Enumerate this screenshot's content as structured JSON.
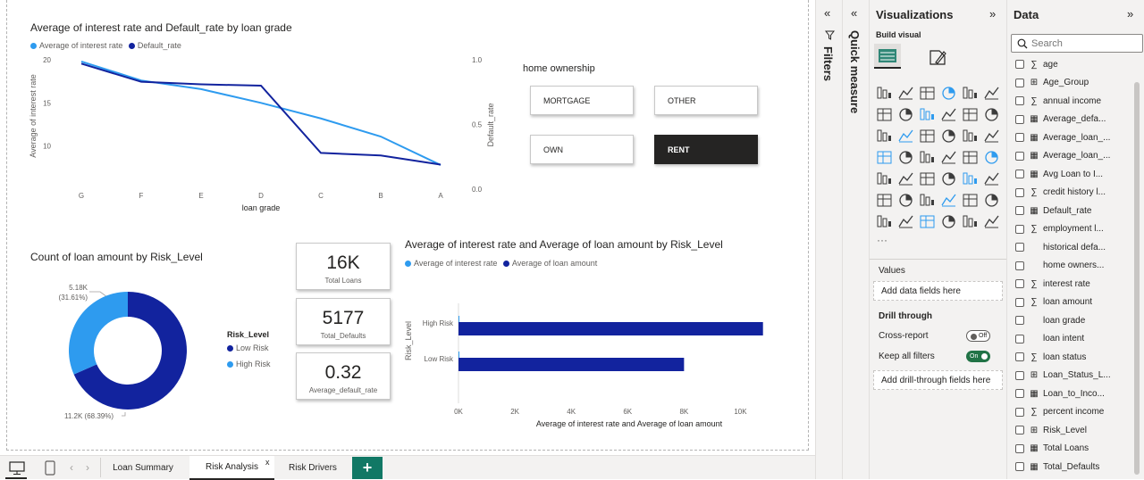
{
  "line_chart": {
    "title": "Average of interest rate and Default_rate by loan grade",
    "legend": [
      {
        "name": "Average of interest rate",
        "color": "#2E9BEF"
      },
      {
        "name": "Default_rate",
        "color": "#12239E"
      }
    ],
    "xlabel": "loan grade",
    "ylabel_left": "Average of interest rate",
    "ylabel_right": "Default_rate"
  },
  "slicer": {
    "title": "home ownership",
    "options": [
      "MORTGAGE",
      "OTHER",
      "OWN",
      "RENT"
    ],
    "selected": "RENT"
  },
  "donut": {
    "title": "Count of loan amount by Risk_Level",
    "legend_title": "Risk_Level",
    "legend": [
      {
        "name": "Low Risk",
        "color": "#12239E"
      },
      {
        "name": "High Risk",
        "color": "#2E9BEF"
      }
    ],
    "label_high_1": "5.18K",
    "label_high_2": "(31.61%)",
    "label_low": "11.2K (68.39%)"
  },
  "cards": [
    {
      "value": "16K",
      "label": "Total Loans"
    },
    {
      "value": "5177",
      "label": "Total_Defaults"
    },
    {
      "value": "0.32",
      "label": "Average_default_rate"
    }
  ],
  "bar_chart": {
    "title": "Average of interest rate and Average of loan amount by Risk_Level",
    "legend": [
      {
        "name": "Average of interest rate",
        "color": "#2E9BEF"
      },
      {
        "name": "Average of loan amount",
        "color": "#12239E"
      }
    ],
    "ylabel": "Risk_Level",
    "xlabel": "Average of interest rate and Average of loan amount"
  },
  "chart_data": [
    {
      "type": "line",
      "title": "Average of interest rate and Default_rate by loan grade",
      "categories": [
        "G",
        "F",
        "E",
        "D",
        "C",
        "B",
        "A"
      ],
      "series": [
        {
          "name": "Average of interest rate",
          "axis": "left",
          "values": [
            19.8,
            17.6,
            16.6,
            15.0,
            13.2,
            11.1,
            7.8
          ]
        },
        {
          "name": "Default_rate",
          "axis": "right",
          "values": [
            0.97,
            0.83,
            0.81,
            0.8,
            0.28,
            0.26,
            0.19
          ]
        }
      ],
      "xlabel": "loan grade",
      "ylabel": "Average of interest rate",
      "ylabel_right": "Default_rate",
      "ylim": [
        5,
        20
      ],
      "yticks": [
        "20",
        "15",
        "10"
      ],
      "ylim_right": [
        0,
        1
      ],
      "yticks_right": [
        "1.0",
        "0.5",
        "0.0"
      ]
    },
    {
      "type": "pie",
      "title": "Count of loan amount by Risk_Level",
      "categories": [
        "Low Risk",
        "High Risk"
      ],
      "values": [
        11200,
        5180
      ],
      "percent": [
        68.39,
        31.61
      ]
    },
    {
      "type": "bar",
      "title": "Average of interest rate and Average of loan amount by Risk_Level",
      "orientation": "horizontal",
      "categories": [
        "High Risk",
        "Low Risk"
      ],
      "series": [
        {
          "name": "Average of interest rate",
          "values": [
            13,
            10
          ]
        },
        {
          "name": "Average of loan amount",
          "values": [
            10800,
            8000
          ]
        }
      ],
      "xlabel": "Average of interest rate and Average of loan amount",
      "ylabel": "Risk_Level",
      "xlim": [
        0,
        11000
      ],
      "xticks": [
        "0K",
        "2K",
        "4K",
        "6K",
        "8K",
        "10K"
      ]
    }
  ],
  "tabs": {
    "items": [
      "Loan Summary",
      "Risk Analysis",
      "Risk Drivers"
    ],
    "active": "Risk Analysis",
    "close_glyph": "x",
    "add_glyph": "+",
    "prev_glyph": "‹",
    "next_glyph": "›"
  },
  "filters_pane": {
    "label": "Filters",
    "collapse_glyph": "«"
  },
  "quick_pane": {
    "label": "Quick measure",
    "collapse_glyph": "«"
  },
  "viz_pane": {
    "title": "Visualizations",
    "expand_glyph": "»",
    "build_visual": "Build visual",
    "more_glyph": "···",
    "values_label": "Values",
    "values_placeholder": "Add data fields here",
    "drill_through": "Drill through",
    "cross_report": "Cross-report",
    "cross_report_state": "Off",
    "keep_filters": "Keep all filters",
    "keep_filters_state": "On",
    "drill_placeholder": "Add drill-through fields here"
  },
  "data_pane": {
    "title": "Data",
    "expand_glyph": "»",
    "search_placeholder": "Search",
    "fields": [
      {
        "name": "age",
        "icon": "sigma-icon",
        "glyph": "∑"
      },
      {
        "name": "Age_Group",
        "icon": "calc-column-icon",
        "glyph": "⊞"
      },
      {
        "name": "annual income",
        "icon": "sigma-icon",
        "glyph": "∑"
      },
      {
        "name": "Average_defa...",
        "icon": "measure-icon",
        "glyph": "▦"
      },
      {
        "name": "Average_loan_...",
        "icon": "measure-icon",
        "glyph": "▦"
      },
      {
        "name": "Average_loan_...",
        "icon": "measure-icon",
        "glyph": "▦"
      },
      {
        "name": "Avg Loan to I...",
        "icon": "measure-icon",
        "glyph": "▦"
      },
      {
        "name": "credit history l...",
        "icon": "sigma-icon",
        "glyph": "∑"
      },
      {
        "name": "Default_rate",
        "icon": "measure-icon",
        "glyph": "▦"
      },
      {
        "name": "employment l...",
        "icon": "sigma-icon",
        "glyph": "∑"
      },
      {
        "name": "historical defa...",
        "icon": "none",
        "glyph": ""
      },
      {
        "name": "home owners...",
        "icon": "none",
        "glyph": ""
      },
      {
        "name": "interest rate",
        "icon": "sigma-icon",
        "glyph": "∑"
      },
      {
        "name": "loan amount",
        "icon": "sigma-icon",
        "glyph": "∑"
      },
      {
        "name": "loan grade",
        "icon": "none",
        "glyph": ""
      },
      {
        "name": "loan intent",
        "icon": "none",
        "glyph": ""
      },
      {
        "name": "loan status",
        "icon": "sigma-icon",
        "glyph": "∑"
      },
      {
        "name": "Loan_Status_L...",
        "icon": "calc-column-icon",
        "glyph": "⊞"
      },
      {
        "name": "Loan_to_Inco...",
        "icon": "measure-icon",
        "glyph": "▦"
      },
      {
        "name": "percent income",
        "icon": "sigma-icon",
        "glyph": "∑"
      },
      {
        "name": "Risk_Level",
        "icon": "calc-column-icon",
        "glyph": "⊞"
      },
      {
        "name": "Total Loans",
        "icon": "measure-icon",
        "glyph": "▦"
      },
      {
        "name": "Total_Defaults",
        "icon": "measure-icon",
        "glyph": "▦"
      }
    ]
  },
  "colors": {
    "light_blue": "#2E9BEF",
    "dark_blue": "#12239E",
    "selected_slicer": "#252423",
    "add_tab": "#117865",
    "toggle_on": "#217346"
  }
}
